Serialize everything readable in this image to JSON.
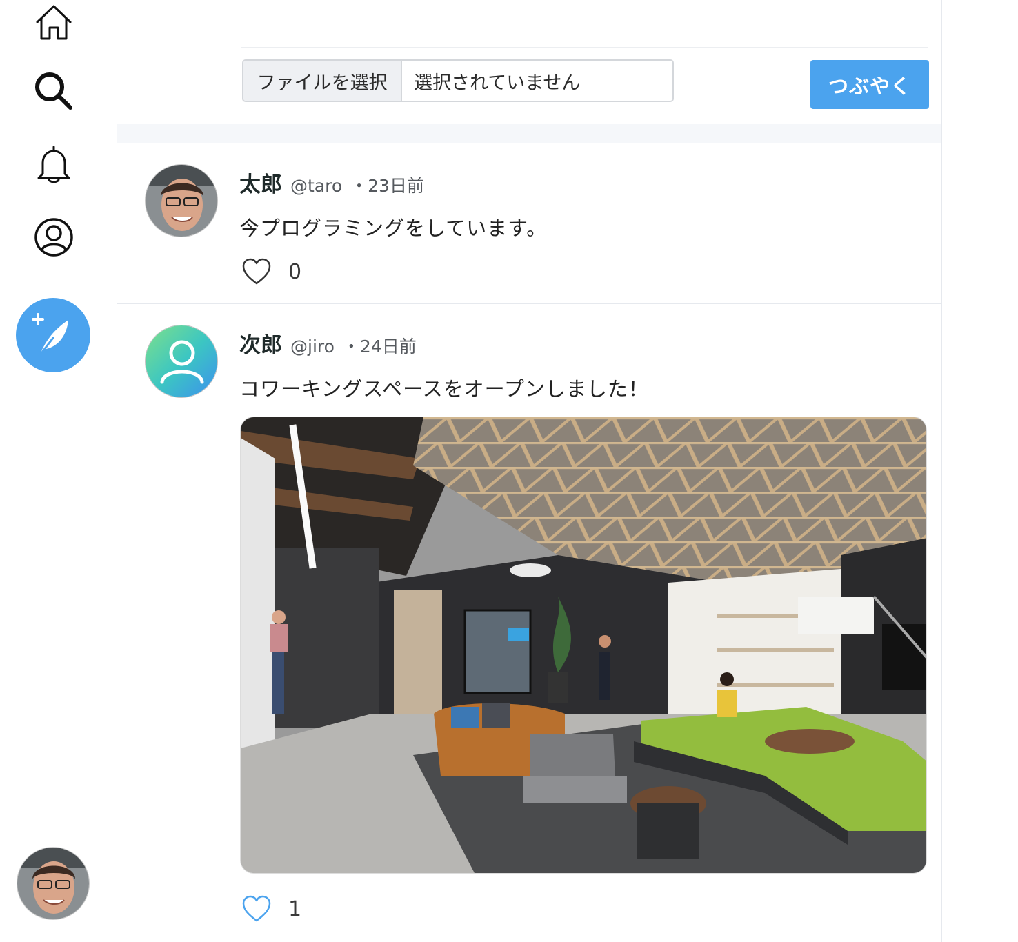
{
  "sidebar": {
    "nav": [
      {
        "name": "home-icon"
      },
      {
        "name": "search-icon"
      },
      {
        "name": "bell-icon"
      },
      {
        "name": "profile-icon"
      }
    ],
    "compose_icon": "feather-plus-icon",
    "accent": "#4ba3ee"
  },
  "composer": {
    "file_button_label": "ファイルを選択",
    "file_status": "選択されていません",
    "submit_label": "つぶやく"
  },
  "posts": [
    {
      "name": "太郎",
      "handle": "@taro",
      "time": "・23日前",
      "text": "今プログラミングをしています。",
      "likes": "0",
      "has_image": false
    },
    {
      "name": "次郎",
      "handle": "@jiro",
      "time": "・24日前",
      "text": "コワーキングスペースをオープンしました！",
      "likes": "1",
      "has_image": true,
      "like_color": "#4ba3ee"
    }
  ]
}
